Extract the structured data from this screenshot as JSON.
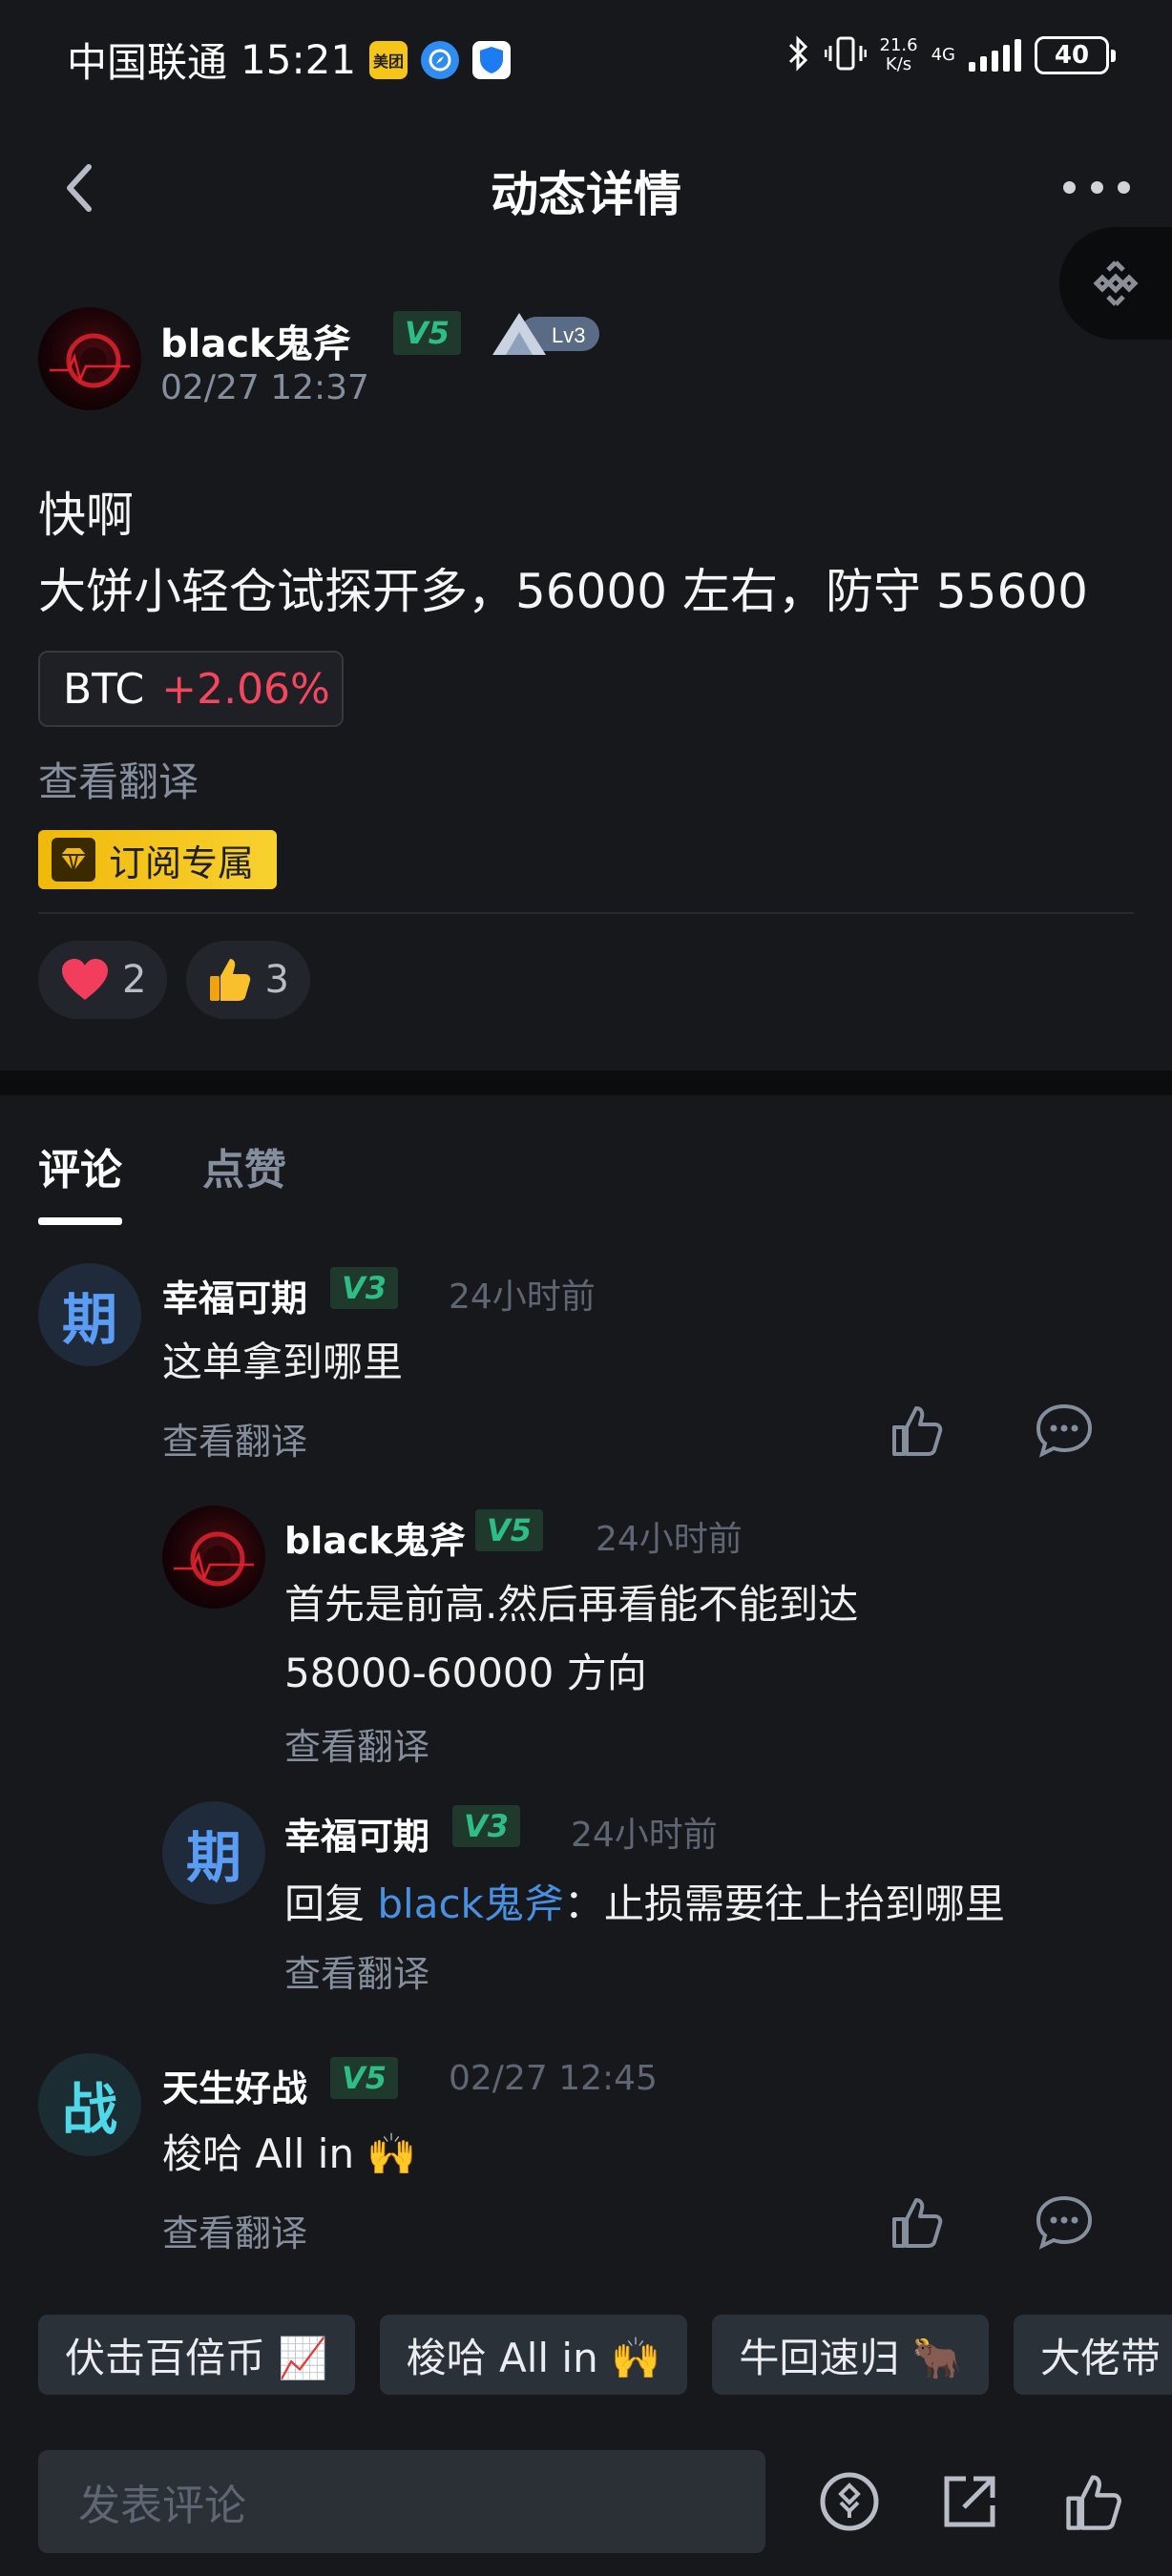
{
  "status_bar": {
    "carrier": "中国联通",
    "time": "15:21",
    "app_badge_1": "美团",
    "speed_value": "21.6",
    "speed_unit": "K/s",
    "network": "4G",
    "battery": "40"
  },
  "header": {
    "title": "动态详情"
  },
  "post": {
    "author": "black鬼斧",
    "vip_label": "V5",
    "level_label": "Lv3",
    "time": "02/27 12:37",
    "text_line1": "快啊",
    "text_line2": "大饼小轻仓试探开多，56000 左右，防守 55600",
    "coin_symbol": "BTC",
    "coin_change": "+2.06%",
    "translate_label": "查看翻译",
    "subscription_label": "订阅专属",
    "reactions": [
      {
        "icon": "heart-icon",
        "count": "2"
      },
      {
        "icon": "thumbs-up-emoji-icon",
        "count": "3"
      }
    ]
  },
  "tabs": [
    {
      "label": "评论",
      "active": true
    },
    {
      "label": "点赞",
      "active": false
    }
  ],
  "comments": [
    {
      "avatar_char": "期",
      "author": "幸福可期",
      "vip": "V3",
      "time": "24小时前",
      "text": "这单拿到哪里",
      "translate": "查看翻译"
    },
    {
      "author": "black鬼斧",
      "vip": "V5",
      "time": "24小时前",
      "text_line1": "首先是前高.然后再看能不能到达",
      "text_line2": "58000-60000 方向",
      "translate": "查看翻译"
    },
    {
      "avatar_char": "期",
      "author": "幸福可期",
      "vip": "V3",
      "time": "24小时前",
      "reply_prefix": "回复",
      "reply_to": "black鬼斧",
      "text": "：止损需要往上抬到哪里",
      "translate": "查看翻译"
    },
    {
      "avatar_char": "战",
      "author": "天生好战",
      "vip": "V5",
      "time": "02/27 12:45",
      "text": "梭哈 All in 🙌",
      "translate": "查看翻译"
    }
  ],
  "quick_replies": [
    "伏击百倍币 📈",
    "梭哈 All in 🙌",
    "牛回速归 🐂",
    "大佬带"
  ],
  "bottom_bar": {
    "input_placeholder": "发表评论"
  },
  "colors": {
    "background": "#17181c",
    "accent_yellow": "#f0b90b",
    "positive_green": "#2ebd85",
    "negative_red": "#f6465d",
    "link_blue": "#4a90e2"
  }
}
